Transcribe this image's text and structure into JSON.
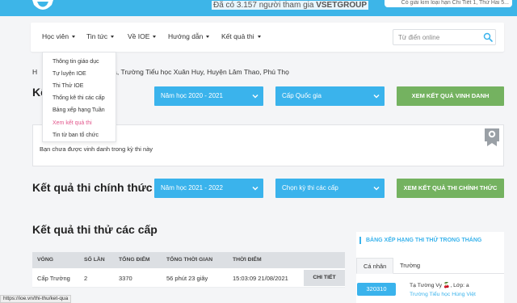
{
  "header": {
    "participants_prefix": "Đã có 3.157 người tham gia ",
    "participants_org": "VSETGROUP",
    "user_box_text": "Có giải kim loại hạn Chi Tiết 1, Thứ Hai 5..."
  },
  "nav": {
    "items": [
      {
        "label": "Học viên"
      },
      {
        "label": "Tin tức"
      },
      {
        "label": "Về IOE"
      },
      {
        "label": "Hướng dẫn"
      },
      {
        "label": "Kết quả thi"
      }
    ],
    "search_placeholder": "Từ điển online"
  },
  "dropdown": {
    "items": [
      "Thông tin giáo dục",
      "Tự luyện IOE",
      "Thi Thử IOE",
      "Thống kê thi các cấp",
      "Bảng xếp hạng Tuần",
      "Xem kết quả thi",
      "Tin từ ban tổ chức"
    ]
  },
  "breadcrumb": {
    "lead": "H",
    "text": "a, Trường Tiểu học Xuân Huy, Huyện Lâm Thao, Phú Thọ"
  },
  "honor": {
    "title": "Kế",
    "year_select": "Năm học 2020 - 2021",
    "level_select": "Cấp Quốc gia",
    "button": "XEM KẾT QUẢ VINH DANH",
    "empty_message": "Bạn chưa được vinh danh trong kỳ thi này"
  },
  "official": {
    "title": "Kết quả thi chính thức",
    "year_select": "Năm học 2021 - 2022",
    "level_select": "Chọn kỳ thi các cấp",
    "button": "XEM KẾT QUẢ THI CHÍNH THỨC"
  },
  "trial": {
    "title": "Kết quả thi thử các cấp",
    "headers": [
      "VÒNG",
      "SỐ LẦN",
      "TỔNG ĐIỂM",
      "TỔNG THỜI GIAN",
      "THỜI ĐIỂM"
    ],
    "rows": [
      {
        "round": "Cấp Trường",
        "attempts": "2",
        "score": "3370",
        "time": "56 phút 23 giây",
        "timestamp": "15:03:09 21/08/2021",
        "action": "CHI TIẾT"
      }
    ]
  },
  "ranking": {
    "title": "BẢNG XẾP HẠNG THI THỬ TRONG THÁNG",
    "tabs": [
      "Cá nhân",
      "Trường"
    ],
    "entry": {
      "score": "320310",
      "name": "Tạ Tường Vy 🍒, Lớp: a",
      "school": "Trường Tiểu học Hùng Việt"
    }
  },
  "status_url": "https://ioe.vn/thi-thu/ket-qua",
  "colors": {
    "accent": "#3ab3ec",
    "header": "#3db5e8",
    "green_button": "#74b260",
    "active_menu": "#e2568b"
  }
}
